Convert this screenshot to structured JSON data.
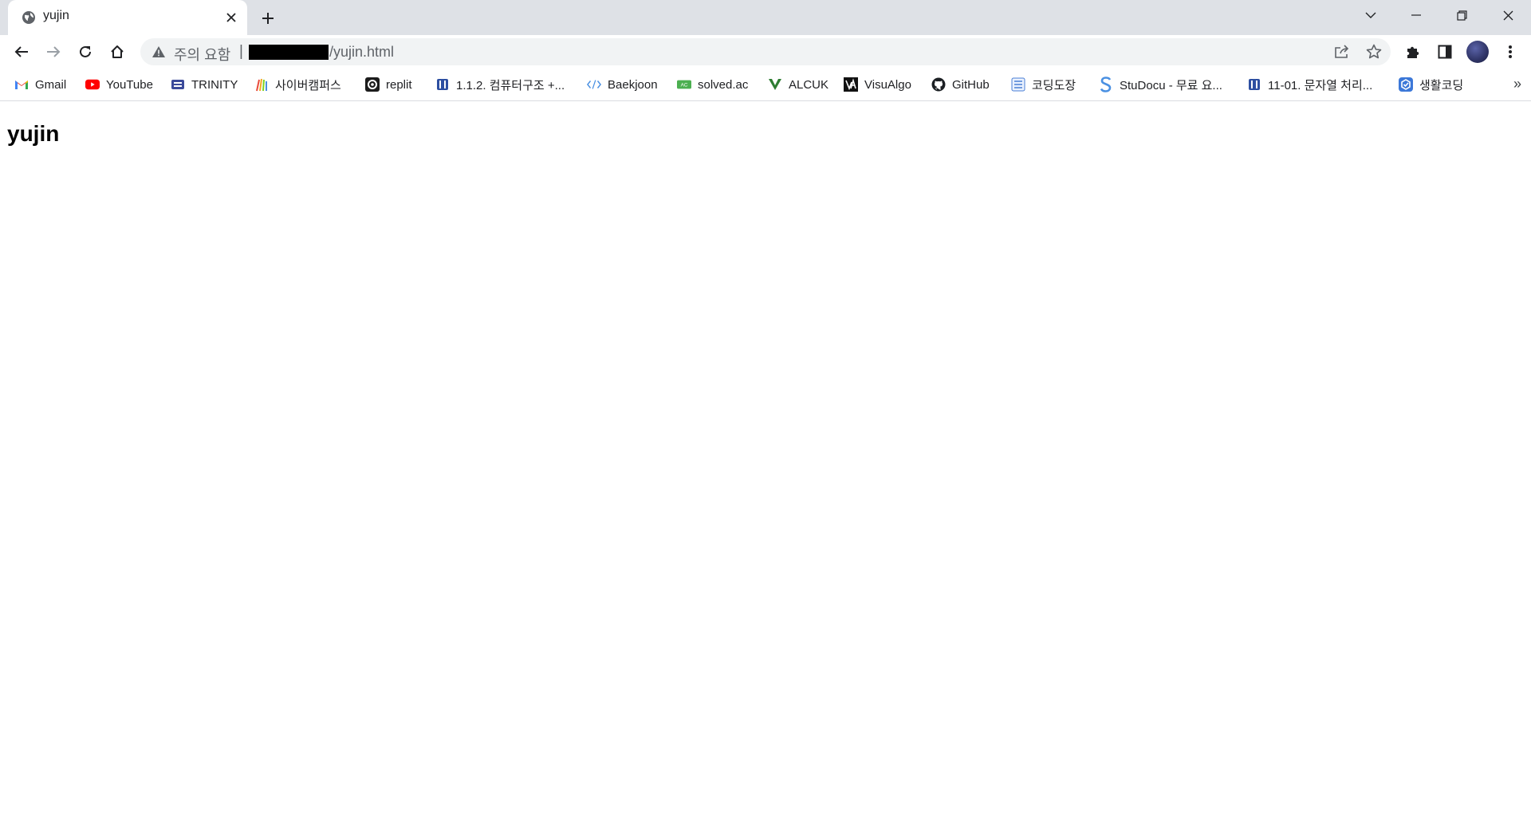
{
  "tab": {
    "title": "yujin",
    "favicon": "globe-icon"
  },
  "window_controls": [
    "chevron-down-icon",
    "minimize-icon",
    "restore-icon",
    "close-icon"
  ],
  "address_bar": {
    "security_label": "주의 요함",
    "separator": "|",
    "url_visible": "/yujin.html",
    "redacted": true
  },
  "bookmarks": [
    {
      "label": "Gmail",
      "icon": "gmail-icon"
    },
    {
      "label": "YouTube",
      "icon": "youtube-icon"
    },
    {
      "label": "TRINITY",
      "icon": "trinity-icon"
    },
    {
      "label": "사이버캠퍼스",
      "icon": "cybercampus-icon"
    },
    {
      "label": "replit",
      "icon": "replit-icon"
    },
    {
      "label": "1.1.2. 컴퓨터구조 +...",
      "icon": "book-icon"
    },
    {
      "label": "Baekjoon",
      "icon": "code-icon"
    },
    {
      "label": "solved.ac",
      "icon": "solvedac-icon"
    },
    {
      "label": "ALCUK",
      "icon": "alcuk-icon"
    },
    {
      "label": "VisuAlgo",
      "icon": "visualgo-icon"
    },
    {
      "label": "GitHub",
      "icon": "github-icon"
    },
    {
      "label": "코딩도장",
      "icon": "codingdojang-icon"
    },
    {
      "label": "StuDocu - 무료 요...",
      "icon": "studocu-icon"
    },
    {
      "label": "11-01. 문자열 처리...",
      "icon": "book-icon"
    },
    {
      "label": "생활코딩",
      "icon": "opentutorials-icon"
    }
  ],
  "more_label": "»",
  "page": {
    "heading": "yujin"
  },
  "colors": {
    "tabstrip": "#dee1e6",
    "omnibox": "#f1f3f4",
    "youtube": "#ff0000",
    "accent": "#1a73e8"
  }
}
